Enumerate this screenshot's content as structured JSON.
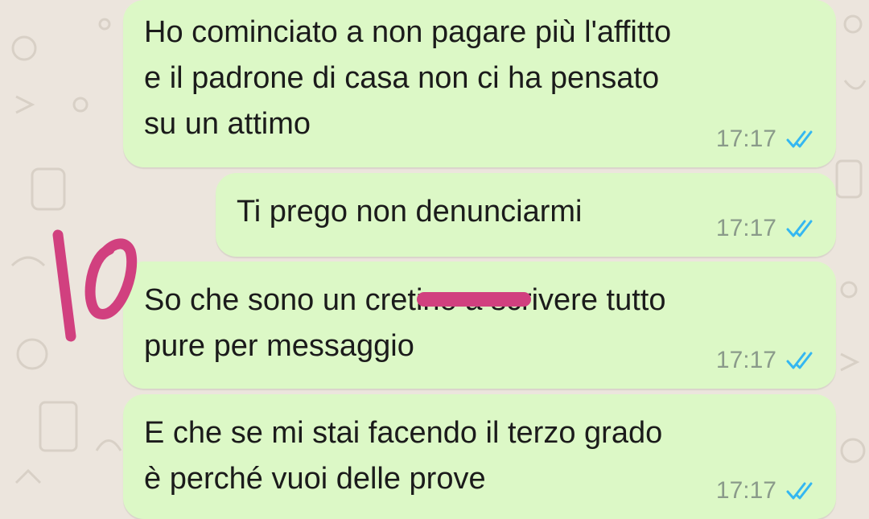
{
  "messages": [
    {
      "text": "Ho cominciato a non pagare più l'affitto\ne il padrone di casa non ci ha pensato\nsu un attimo",
      "time": "17:17",
      "status": "read"
    },
    {
      "text": "Ti prego non denunciarmi",
      "time": "17:17",
      "status": "read"
    },
    {
      "text": "So che sono un cretino a scrivere tutto\npure per messaggio",
      "time": "17:17",
      "status": "read"
    },
    {
      "text": "E che se mi stai facendo il terzo grado\nè perché vuoi delle prove",
      "time": "17:17",
      "status": "read"
    }
  ],
  "annotation": {
    "number": "10",
    "color": "#d1407f"
  },
  "icons": {
    "read_receipt": "double-check-icon",
    "read_receipt_color": "#34b7f1"
  }
}
